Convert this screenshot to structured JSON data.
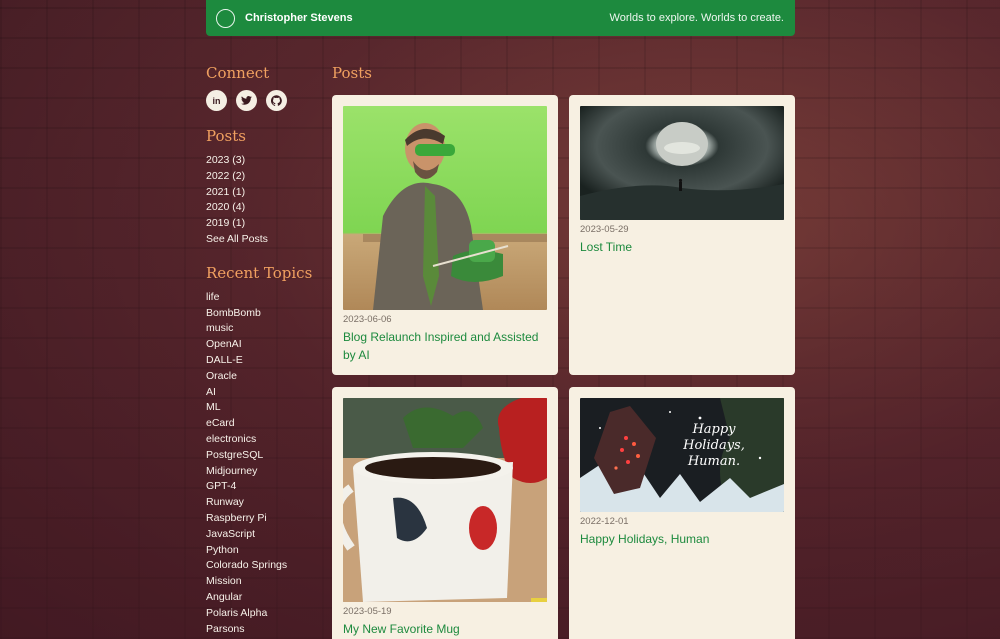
{
  "header": {
    "site_name": "Christopher Stevens",
    "tagline": "Worlds to explore. Worlds to create."
  },
  "sidebar": {
    "connect_heading": "Connect",
    "social": [
      {
        "name": "linkedin-icon",
        "glyph": "in"
      },
      {
        "name": "twitter-icon",
        "glyph": "🐦"
      },
      {
        "name": "github-icon",
        "glyph": "●"
      }
    ],
    "posts_heading": "Posts",
    "years": [
      "2023 (3)",
      "2022 (2)",
      "2021 (1)",
      "2020 (4)",
      "2019 (1)"
    ],
    "see_all": "See All Posts",
    "topics_heading": "Recent Topics",
    "topics": [
      "life",
      "BombBomb",
      "music",
      "OpenAI",
      "DALL-E",
      "Oracle",
      "AI",
      "ML",
      "eCard",
      "electronics",
      "PostgreSQL",
      "Midjourney",
      "GPT-4",
      "Runway",
      "Raspberry Pi",
      "JavaScript",
      "Python",
      "Colorado Springs",
      "Mission",
      "Angular",
      "Polaris Alpha",
      "Parsons"
    ]
  },
  "main": {
    "title": "Posts",
    "posts": [
      {
        "date": "2023-06-06",
        "title": "Blog Relaunch Inspired and Assisted by AI"
      },
      {
        "date": "2023-05-29",
        "title": "Lost Time"
      },
      {
        "date": "2023-05-19",
        "title": "My New Favorite Mug"
      },
      {
        "date": "2022-12-01",
        "title": "Happy Holidays, Human",
        "image_text": "Happy Holidays, Human."
      }
    ]
  },
  "colors": {
    "accent_green": "#1d8a3e",
    "heading_orange": "#f0a060",
    "card_bg": "#f7f0e2"
  }
}
